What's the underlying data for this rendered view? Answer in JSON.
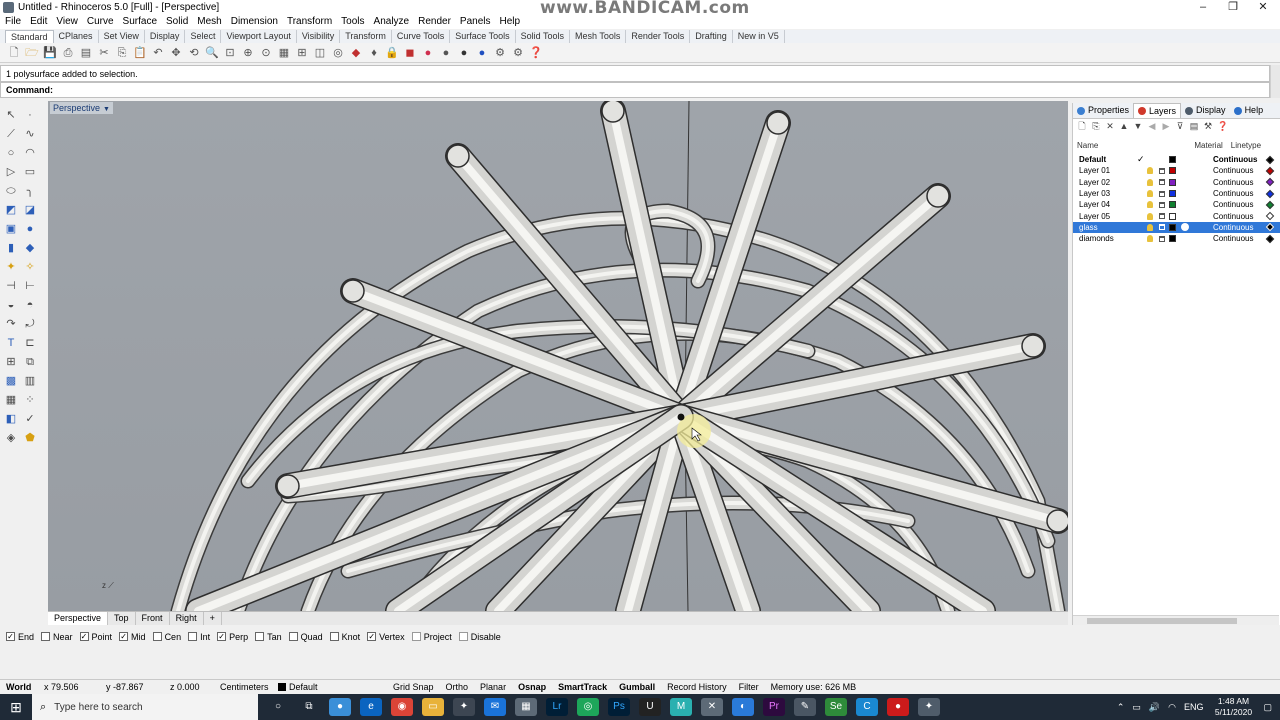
{
  "window": {
    "title": "Untitled - Rhinoceros 5.0 [Full] - [Perspective]",
    "watermark": "www.BANDICAM.com",
    "controls": [
      "–",
      "❐",
      "✕"
    ]
  },
  "menu": [
    "File",
    "Edit",
    "View",
    "Curve",
    "Surface",
    "Solid",
    "Mesh",
    "Dimension",
    "Transform",
    "Tools",
    "Analyze",
    "Render",
    "Panels",
    "Help"
  ],
  "toolbar_tabs": [
    "Standard",
    "CPlanes",
    "Set View",
    "Display",
    "Select",
    "Viewport Layout",
    "Visibility",
    "Transform",
    "Curve Tools",
    "Surface Tools",
    "Solid Tools",
    "Mesh Tools",
    "Render Tools",
    "Drafting",
    "New in V5"
  ],
  "command": {
    "history": "1 polysurface added to selection.",
    "prompt": "Command:",
    "value": ""
  },
  "viewport": {
    "label": "Perspective",
    "caret": "▼",
    "axis_label": "z"
  },
  "viewport_tabs": [
    "Perspective",
    "Top",
    "Front",
    "Right",
    "+"
  ],
  "osnaps": [
    {
      "label": "End",
      "checked": true
    },
    {
      "label": "Near",
      "checked": false
    },
    {
      "label": "Point",
      "checked": true
    },
    {
      "label": "Mid",
      "checked": true
    },
    {
      "label": "Cen",
      "checked": false
    },
    {
      "label": "Int",
      "checked": false
    },
    {
      "label": "Perp",
      "checked": true
    },
    {
      "label": "Tan",
      "checked": false
    },
    {
      "label": "Quad",
      "checked": false
    },
    {
      "label": "Knot",
      "checked": false
    },
    {
      "label": "Vertex",
      "checked": true
    },
    {
      "label": "Project",
      "checked": false
    },
    {
      "label": "Disable",
      "checked": false
    }
  ],
  "status": {
    "world": "World",
    "x": "x 79.506",
    "y": "y -87.867",
    "z": "z 0.000",
    "units": "Centimeters",
    "layer": "Default",
    "grid_snap": "Grid Snap",
    "ortho": "Ortho",
    "planar": "Planar",
    "osnap": "Osnap",
    "smarttrack": "SmartTrack",
    "gumball": "Gumball",
    "record_history": "Record History",
    "filter": "Filter",
    "memory": "Memory use: 626 MB"
  },
  "panel": {
    "tabs": [
      "Properties",
      "Layers",
      "Display",
      "Help"
    ],
    "columns": {
      "name": "Name",
      "material": "Material",
      "linetype": "Linetype"
    },
    "layers": [
      {
        "name": "Default",
        "current": true,
        "color": "#000000",
        "linetype": "Continuous"
      },
      {
        "name": "Layer 01",
        "current": false,
        "color": "#c00000",
        "linetype": "Continuous"
      },
      {
        "name": "Layer 02",
        "current": false,
        "color": "#8020c0",
        "linetype": "Continuous"
      },
      {
        "name": "Layer 03",
        "current": false,
        "color": "#1030e0",
        "linetype": "Continuous"
      },
      {
        "name": "Layer 04",
        "current": false,
        "color": "#108030",
        "linetype": "Continuous"
      },
      {
        "name": "Layer 05",
        "current": false,
        "color": "#ffffff",
        "linetype": "Continuous"
      },
      {
        "name": "glass",
        "current": false,
        "color": "#000000",
        "linetype": "Continuous",
        "selected": true
      },
      {
        "name": "diamonds",
        "current": false,
        "color": "#000000",
        "linetype": "Continuous"
      }
    ],
    "current_mark": "✓"
  },
  "taskbar": {
    "search_placeholder": "Type here to search",
    "language": "ENG",
    "time": "1:48 AM",
    "date": "5/11/2020"
  }
}
